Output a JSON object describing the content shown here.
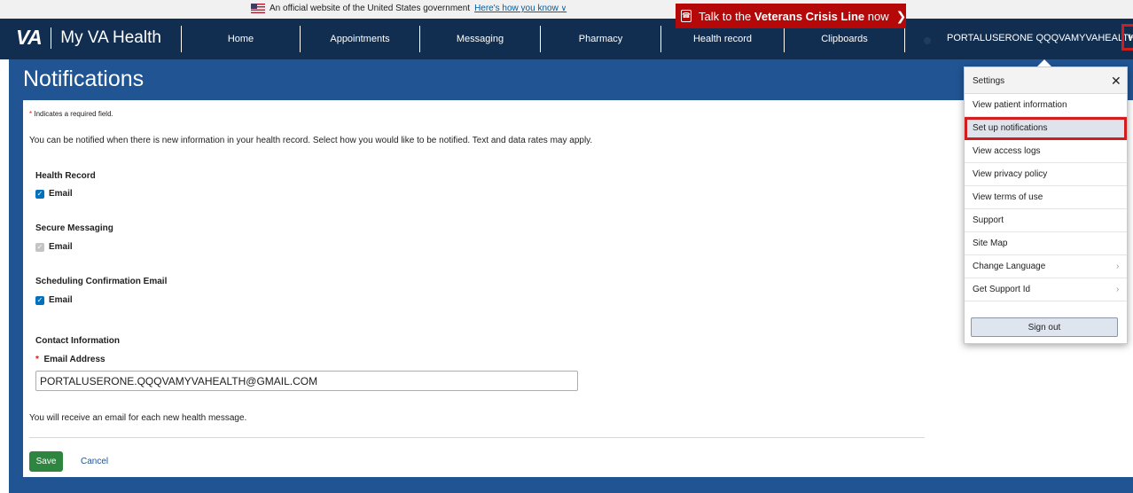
{
  "gov_banner": {
    "text": "An official website of the United States government",
    "link": "Here's how you know",
    "chevron_icon": "chevron-down-icon"
  },
  "crisis": {
    "prefix": "Talk to the",
    "bold": "Veterans Crisis Line",
    "suffix": "now"
  },
  "header": {
    "logo_mark": "VA",
    "logo_name": "My VA Health",
    "nav": [
      "Home",
      "Appointments",
      "Messaging",
      "Pharmacy",
      "Health record",
      "Clipboards"
    ],
    "user_name": "PORTALUSERONE QQQVAMYVAHEALTH"
  },
  "page": {
    "title": "Notifications",
    "required_note": "Indicates a required field.",
    "intro": "You can be notified when there is new information in your health record. Select how you would like to be notified. Text and data rates may apply.",
    "sections": [
      {
        "heading": "Health Record",
        "option": "Email",
        "checked": true,
        "disabled": false
      },
      {
        "heading": "Secure Messaging",
        "option": "Email",
        "checked": true,
        "disabled": true
      },
      {
        "heading": "Scheduling Confirmation Email",
        "option": "Email",
        "checked": true,
        "disabled": false
      }
    ],
    "contact_heading": "Contact Information",
    "email_label": "Email Address",
    "email_value": "PORTALUSERONE.QQQVAMYVAHEALTH@GMAIL.COM",
    "message_note": "You will receive an email for each new health message.",
    "save_label": "Save",
    "cancel_label": "Cancel"
  },
  "dropdown": {
    "title": "Settings",
    "items": [
      {
        "label": "View patient information",
        "active": false,
        "submenu": false
      },
      {
        "label": "Set up notifications",
        "active": true,
        "submenu": false
      },
      {
        "label": "View access logs",
        "active": false,
        "submenu": false
      },
      {
        "label": "View privacy policy",
        "active": false,
        "submenu": false
      },
      {
        "label": "View terms of use",
        "active": false,
        "submenu": false
      },
      {
        "label": "Support",
        "active": false,
        "submenu": false
      },
      {
        "label": "Site Map",
        "active": false,
        "submenu": false
      },
      {
        "label": "Change Language",
        "active": false,
        "submenu": true
      },
      {
        "label": "Get Support Id",
        "active": false,
        "submenu": true
      }
    ],
    "sign_out": "Sign out"
  },
  "colors": {
    "nav_bg": "#112e51",
    "page_bg": "#205493",
    "crisis_red": "#b50909",
    "save_green": "#2e8540",
    "highlight_red": "#d11d1d"
  }
}
